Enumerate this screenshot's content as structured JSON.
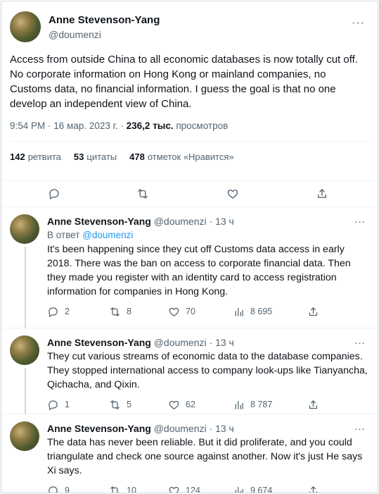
{
  "main_tweet": {
    "author_name": "Anne Stevenson-Yang",
    "author_handle": "@doumenzi",
    "more_icon": "···",
    "text": "Access from outside China to all economic databases is now totally cut off. No corporate information on Hong Kong or mainland companies, no Customs data, no financial information. I guess the goal is that no one develop an independent view of China.",
    "timestamp": "9:54 PM · 16 мар. 2023 г. · ",
    "views_count": "236,2 тыс.",
    "views_label": " просмотров",
    "retweets_count": "142",
    "retweets_label": "ретвита",
    "quotes_count": "53",
    "quotes_label": "цитаты",
    "likes_count": "478",
    "likes_label": "отметок «Нравится»"
  },
  "replies": [
    {
      "author_name": "Anne Stevenson-Yang",
      "author_handle": "@doumenzi",
      "time": " · 13 ч",
      "reply_to_label": "В ответ ",
      "reply_to_handle": "@doumenzi",
      "text": "It's been happening since they cut off Customs data access in early 2018. There was the ban on access to corporate financial data. Then they made you register with an identity card to access registration information for companies in Hong Kong.",
      "replies": "2",
      "retweets": "8",
      "likes": "70",
      "views": "8 695"
    },
    {
      "author_name": "Anne Stevenson-Yang",
      "author_handle": "@doumenzi",
      "time": " · 13 ч",
      "text": "They cut various streams of economic data to the database companies. They stopped international access to company look-ups like Tianyancha, Qichacha, and Qixin.",
      "replies": "1",
      "retweets": "5",
      "likes": "62",
      "views": "8 787"
    },
    {
      "author_name": "Anne Stevenson-Yang",
      "author_handle": "@doumenzi",
      "time": " · 13 ч",
      "text": "The data has never been reliable. But it did proliferate, and you could triangulate and check one source against another. Now it's just He says Xi says.",
      "replies": "9",
      "retweets": "10",
      "likes": "124",
      "views": "9 674"
    }
  ],
  "colors": {
    "link": "#1d9bf0",
    "muted": "#536471",
    "text": "#0f1419",
    "border": "#eff3f4"
  }
}
